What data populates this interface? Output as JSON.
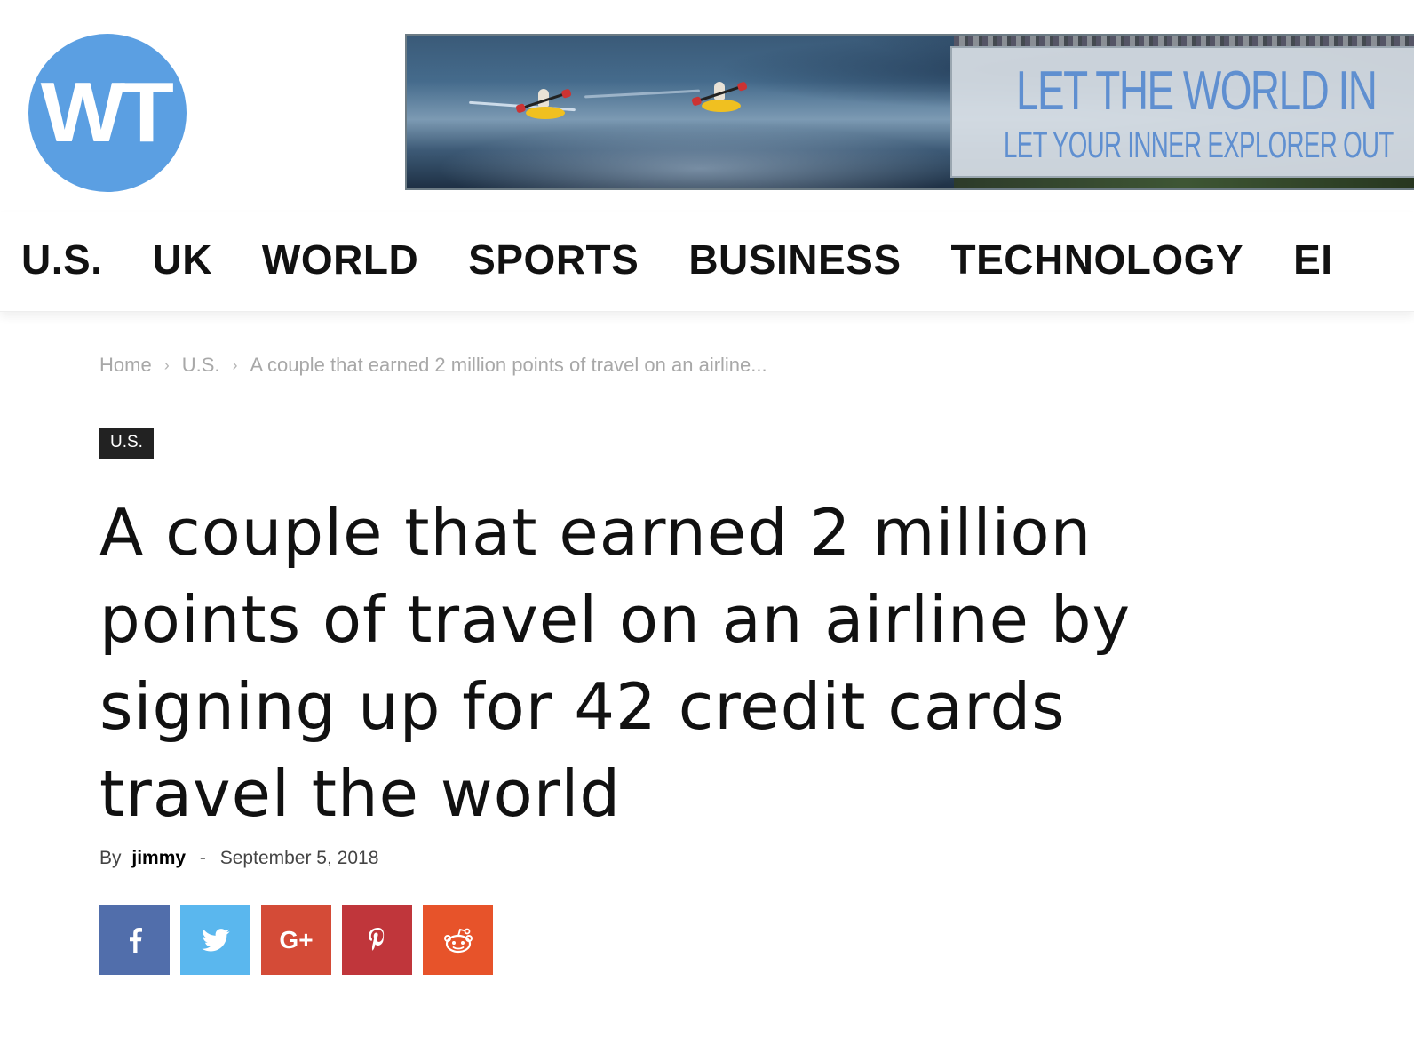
{
  "logo": {
    "text": "WT",
    "color": "#5b9fe2"
  },
  "banner": {
    "headline": "LET THE WORLD IN",
    "subline": "LET YOUR INNER EXPLORER OUT",
    "text_color": "#5f8fd0"
  },
  "nav": {
    "items": [
      {
        "label": "U.S."
      },
      {
        "label": "UK"
      },
      {
        "label": "WORLD"
      },
      {
        "label": "SPORTS"
      },
      {
        "label": "BUSINESS"
      },
      {
        "label": "TECHNOLOGY"
      },
      {
        "label": "EI"
      }
    ]
  },
  "breadcrumb": {
    "home": "Home",
    "category": "U.S.",
    "current": "A couple that earned 2 million points of travel on an airline...",
    "separator": "›"
  },
  "article": {
    "category_badge": "U.S.",
    "title": "A couple that earned 2 million points of travel on an airline by signing up for 42 credit cards travel the world",
    "by_label": "By",
    "author": "jimmy",
    "dash": "-",
    "date": "September 5, 2018"
  },
  "share": {
    "buttons": [
      {
        "name": "facebook",
        "icon": "facebook-icon",
        "color": "#516eab"
      },
      {
        "name": "twitter",
        "icon": "twitter-icon",
        "color": "#5ab7ee"
      },
      {
        "name": "google-plus",
        "icon": "google-plus-icon",
        "color": "#d44b37",
        "label": "G+"
      },
      {
        "name": "pinterest",
        "icon": "pinterest-icon",
        "color": "#c0363b"
      },
      {
        "name": "reddit",
        "icon": "reddit-icon",
        "color": "#e7532a"
      }
    ]
  }
}
